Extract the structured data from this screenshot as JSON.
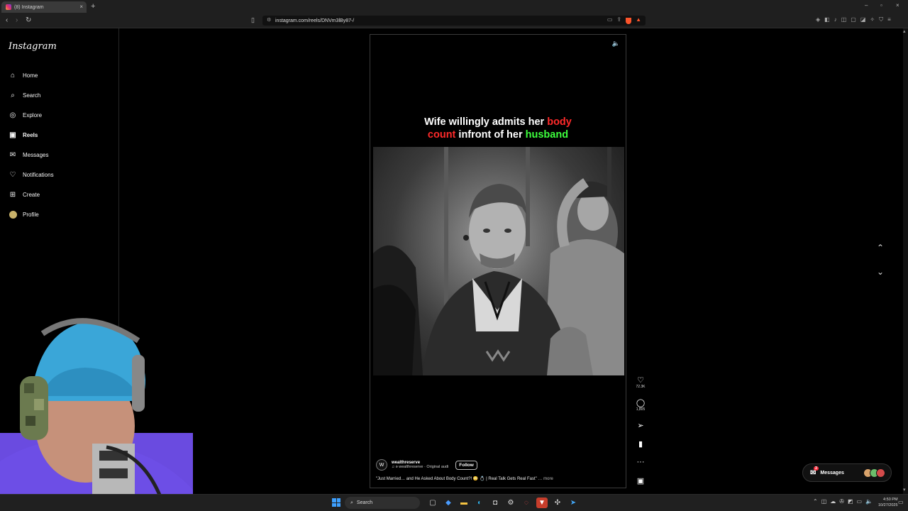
{
  "browser": {
    "tab_title": "(8) Instagram",
    "tab_close": "×",
    "new_tab": "+",
    "url": "instagram.com/reels/DNVm3lBy87-/",
    "back": "‹",
    "forward": "›",
    "reload": "↻",
    "bookmark": "▯",
    "minimize": "–",
    "maximize": "▫",
    "close": "×"
  },
  "sidebar": {
    "logo": "Instagram",
    "items": [
      {
        "label": "Home",
        "icon": "⌂"
      },
      {
        "label": "Search",
        "icon": "⌕"
      },
      {
        "label": "Explore",
        "icon": "◎"
      },
      {
        "label": "Reels",
        "icon": "▣"
      },
      {
        "label": "Messages",
        "icon": "✉"
      },
      {
        "label": "Notifications",
        "icon": "♡"
      },
      {
        "label": "Create",
        "icon": "⊞"
      },
      {
        "label": "Profile",
        "icon": ""
      }
    ],
    "more_icon": "☰"
  },
  "reel": {
    "mute_icon": "🔈",
    "title_part1": "Wife willingly admits her ",
    "title_red1": "body",
    "title_red2": "count",
    "title_part2": " infront of her ",
    "title_green": "husband",
    "author": "wealthreserve",
    "audio": "♫ ə  wealthreserve · Original audi",
    "follow": "Follow",
    "post_caption": "\"Just Married… and He Asked About Body Count?! 😳 💍 | Real Talk Gets Real Fast\"",
    "more": "… more",
    "likes": "72.3K",
    "comments": "1,805"
  },
  "nav": {
    "up": "⌃",
    "down": "⌄"
  },
  "messages_pill": {
    "label": "Messages",
    "badge": "3"
  },
  "taskbar": {
    "search_placeholder": "Search",
    "time": "4:50 PM",
    "date": "10/27/2025"
  }
}
